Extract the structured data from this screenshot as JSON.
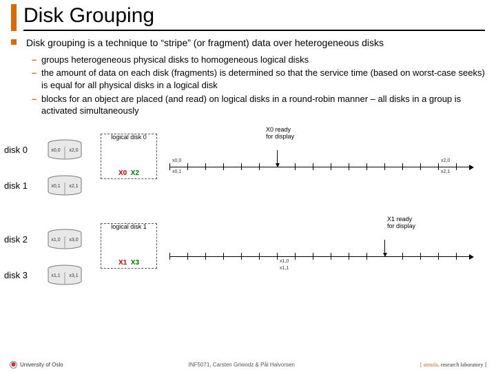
{
  "title": "Disk Grouping",
  "bullets": {
    "main": "Disk grouping is a technique to “stripe” (or fragment) data over heterogeneous disks",
    "sub": [
      "groups heterogeneous physical disks to homogeneous logical disks",
      "the amount of data on each disk (fragments) is determined so that the service time (based on worst-case seeks) is equal for all physical disks in a logical disk",
      "blocks for an object are placed (and read) on logical disks in a round-robin manner – all disks in a group is activated simultaneously"
    ]
  },
  "disks": [
    "disk 0",
    "disk 1",
    "disk 2",
    "disk 3"
  ],
  "cyl": {
    "d0a": "x0,0",
    "d0b": "x2,0",
    "d1a": "x0,1",
    "d1b": "x2,1",
    "d2a": "x1,0",
    "d2b": "x3,0",
    "d3a": "x1,1",
    "d3b": "x3,1"
  },
  "groups": {
    "g0": {
      "title": "logical disk 0",
      "xa": "X0",
      "xb": "X2"
    },
    "g1": {
      "title": "logical disk 1",
      "xa": "X1",
      "xb": "X3"
    }
  },
  "ready": {
    "r0a": "X0 ready",
    "r0b": "for display",
    "r1a": "X1 ready",
    "r1b": "for display"
  },
  "tlabels": {
    "t0": "x0,0",
    "t1": "x0,1",
    "t2": "x2,0",
    "t3": "x2,1",
    "t4": "x1,0",
    "t5": "x1,1"
  },
  "footer": {
    "uio": "University of Oslo",
    "mid": "INF5071, Carsten Griwodz & Pål Halvorsen",
    "sim_a": "[ simula",
    "sim_b": ". research laboratory ]"
  }
}
